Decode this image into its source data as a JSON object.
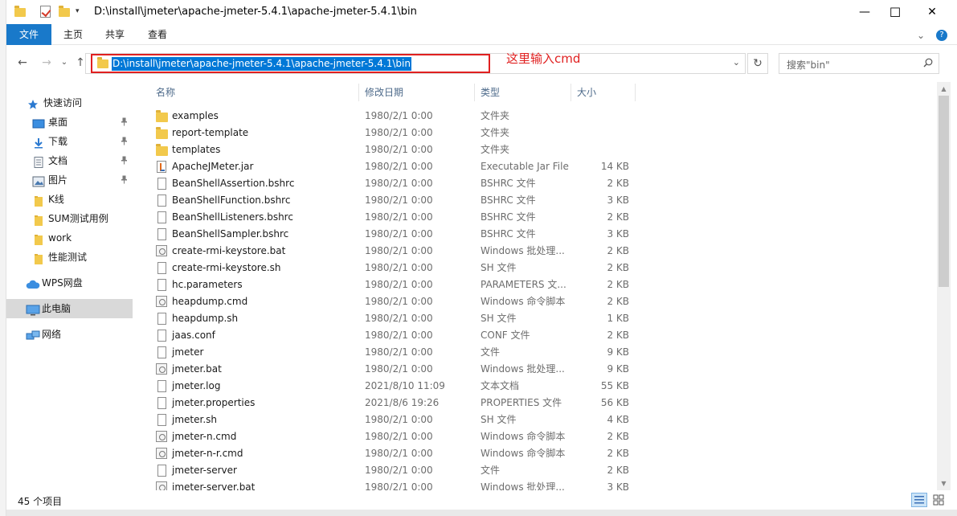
{
  "window": {
    "title_path": "D:\\install\\jmeter\\apache-jmeter-5.4.1\\apache-jmeter-5.4.1\\bin",
    "minimize": "—",
    "maximize": "☐",
    "close": "✕"
  },
  "ribbon": {
    "tabs": [
      "文件",
      "主页",
      "共享",
      "查看"
    ],
    "collapse": "⌄",
    "help": "?"
  },
  "address": {
    "path": "D:\\install\\jmeter\\apache-jmeter-5.4.1\\apache-jmeter-5.4.1\\bin",
    "annotation": "这里输入cmd",
    "search_placeholder": "搜索\"bin\"",
    "back": "←",
    "forward": "→",
    "recent": "⌄",
    "up": "↑",
    "refresh": "↻",
    "dropdown": "⌄"
  },
  "nav": {
    "items": [
      {
        "label": "快速访问",
        "icon": "star-icon",
        "pinned": false
      },
      {
        "label": "桌面",
        "icon": "desktop-icon",
        "pinned": true
      },
      {
        "label": "下载",
        "icon": "download-icon",
        "pinned": true
      },
      {
        "label": "文档",
        "icon": "document-icon",
        "pinned": true
      },
      {
        "label": "图片",
        "icon": "picture-icon",
        "pinned": true
      },
      {
        "label": "K线",
        "icon": "folder-icon",
        "pinned": false
      },
      {
        "label": "SUM测试用例",
        "icon": "folder-icon",
        "pinned": false
      },
      {
        "label": "work",
        "icon": "folder-icon",
        "pinned": false
      },
      {
        "label": "性能测试",
        "icon": "folder-icon",
        "pinned": false
      },
      {
        "label": "WPS网盘",
        "icon": "cloud-icon",
        "pinned": false
      },
      {
        "label": "此电脑",
        "icon": "computer-icon",
        "pinned": false
      },
      {
        "label": "网络",
        "icon": "network-icon",
        "pinned": false
      }
    ],
    "pin_glyph": "📌"
  },
  "columns": {
    "name": "名称",
    "date": "修改日期",
    "type": "类型",
    "size": "大小",
    "sort_glyph": "^"
  },
  "files": [
    {
      "name": "examples",
      "date": "1980/2/1 0:00",
      "type": "文件夹",
      "size": "",
      "icon": "folder"
    },
    {
      "name": "report-template",
      "date": "1980/2/1 0:00",
      "type": "文件夹",
      "size": "",
      "icon": "folder"
    },
    {
      "name": "templates",
      "date": "1980/2/1 0:00",
      "type": "文件夹",
      "size": "",
      "icon": "folder"
    },
    {
      "name": "ApacheJMeter.jar",
      "date": "1980/2/1 0:00",
      "type": "Executable Jar File",
      "size": "14 KB",
      "icon": "jar"
    },
    {
      "name": "BeanShellAssertion.bshrc",
      "date": "1980/2/1 0:00",
      "type": "BSHRC 文件",
      "size": "2 KB",
      "icon": "doc"
    },
    {
      "name": "BeanShellFunction.bshrc",
      "date": "1980/2/1 0:00",
      "type": "BSHRC 文件",
      "size": "3 KB",
      "icon": "doc"
    },
    {
      "name": "BeanShellListeners.bshrc",
      "date": "1980/2/1 0:00",
      "type": "BSHRC 文件",
      "size": "2 KB",
      "icon": "doc"
    },
    {
      "name": "BeanShellSampler.bshrc",
      "date": "1980/2/1 0:00",
      "type": "BSHRC 文件",
      "size": "3 KB",
      "icon": "doc"
    },
    {
      "name": "create-rmi-keystore.bat",
      "date": "1980/2/1 0:00",
      "type": "Windows 批处理...",
      "size": "2 KB",
      "icon": "bat"
    },
    {
      "name": "create-rmi-keystore.sh",
      "date": "1980/2/1 0:00",
      "type": "SH 文件",
      "size": "2 KB",
      "icon": "doc"
    },
    {
      "name": "hc.parameters",
      "date": "1980/2/1 0:00",
      "type": "PARAMETERS 文...",
      "size": "2 KB",
      "icon": "doc"
    },
    {
      "name": "heapdump.cmd",
      "date": "1980/2/1 0:00",
      "type": "Windows 命令脚本",
      "size": "2 KB",
      "icon": "bat"
    },
    {
      "name": "heapdump.sh",
      "date": "1980/2/1 0:00",
      "type": "SH 文件",
      "size": "1 KB",
      "icon": "doc"
    },
    {
      "name": "jaas.conf",
      "date": "1980/2/1 0:00",
      "type": "CONF 文件",
      "size": "2 KB",
      "icon": "doc"
    },
    {
      "name": "jmeter",
      "date": "1980/2/1 0:00",
      "type": "文件",
      "size": "9 KB",
      "icon": "doc"
    },
    {
      "name": "jmeter.bat",
      "date": "1980/2/1 0:00",
      "type": "Windows 批处理...",
      "size": "9 KB",
      "icon": "bat"
    },
    {
      "name": "jmeter.log",
      "date": "2021/8/10 11:09",
      "type": "文本文档",
      "size": "55 KB",
      "icon": "doc"
    },
    {
      "name": "jmeter.properties",
      "date": "2021/8/6 19:26",
      "type": "PROPERTIES 文件",
      "size": "56 KB",
      "icon": "doc"
    },
    {
      "name": "jmeter.sh",
      "date": "1980/2/1 0:00",
      "type": "SH 文件",
      "size": "4 KB",
      "icon": "doc"
    },
    {
      "name": "jmeter-n.cmd",
      "date": "1980/2/1 0:00",
      "type": "Windows 命令脚本",
      "size": "2 KB",
      "icon": "bat"
    },
    {
      "name": "jmeter-n-r.cmd",
      "date": "1980/2/1 0:00",
      "type": "Windows 命令脚本",
      "size": "2 KB",
      "icon": "bat"
    },
    {
      "name": "jmeter-server",
      "date": "1980/2/1 0:00",
      "type": "文件",
      "size": "2 KB",
      "icon": "doc"
    },
    {
      "name": "jmeter-server.bat",
      "date": "1980/2/1 0:00",
      "type": "Windows 批处理...",
      "size": "3 KB",
      "icon": "bat"
    }
  ],
  "status": {
    "count": "45 个项目"
  },
  "colors": {
    "accent": "#1979ca",
    "selection": "#0078d7",
    "annotation": "#e02020"
  }
}
